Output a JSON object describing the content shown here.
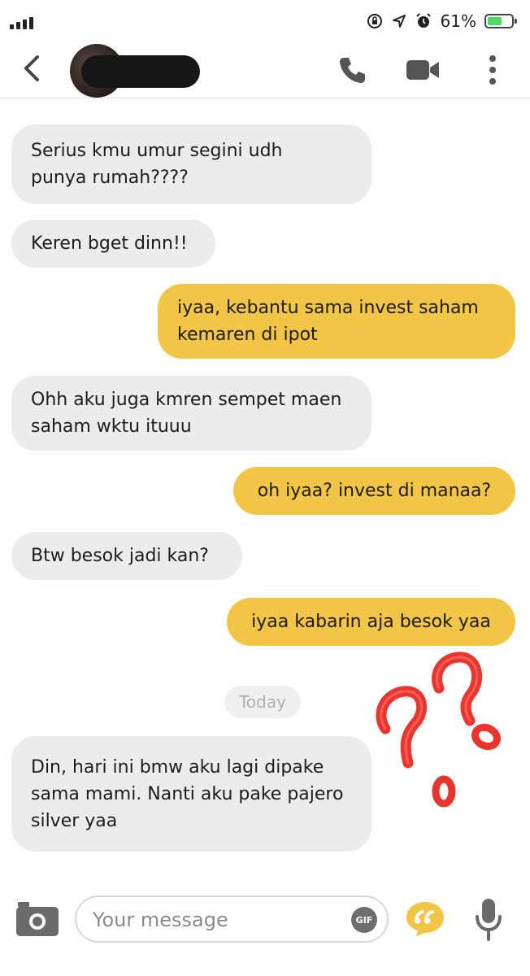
{
  "status_bar": {
    "battery_percent": "61%",
    "battery_level": 0.61,
    "icons": [
      "signal-icon",
      "orientation-lock-icon",
      "location-icon",
      "alarm-icon",
      "battery-icon"
    ]
  },
  "header": {
    "icons": [
      "back-chevron-icon",
      "phone-icon",
      "video-camera-icon",
      "more-vertical-icon"
    ]
  },
  "messages": [
    {
      "side": "in",
      "text": "Serius kmu umur segini udh\npunya rumah????"
    },
    {
      "side": "in",
      "text": "Keren bget dinn!!"
    },
    {
      "side": "out",
      "text": "iyaa, kebantu sama invest saham\nkemaren di ipot"
    },
    {
      "side": "in",
      "text": "Ohh aku juga kmren sempet maen\nsaham wktu ituuu"
    },
    {
      "side": "out",
      "text": "oh iyaa? invest di manaa?"
    },
    {
      "side": "in",
      "text": "Btw besok jadi kan?"
    },
    {
      "side": "out",
      "text": "iyaa kabarin aja besok yaa"
    },
    {
      "side": "in",
      "text": "Din, hari ini bmw aku lagi dipake\nsama mami. Nanti aku pake pajero\nsilver yaa"
    }
  ],
  "day_separator": "Today",
  "composer": {
    "placeholder": "Your message",
    "gif_label": "GIF",
    "icons": [
      "camera-icon",
      "gif-icon",
      "quote-icon",
      "microphone-icon"
    ]
  },
  "colors": {
    "incoming_bubble": "#ececec",
    "outgoing_bubble": "#f2c547",
    "annotation_red": "#e8362f"
  }
}
